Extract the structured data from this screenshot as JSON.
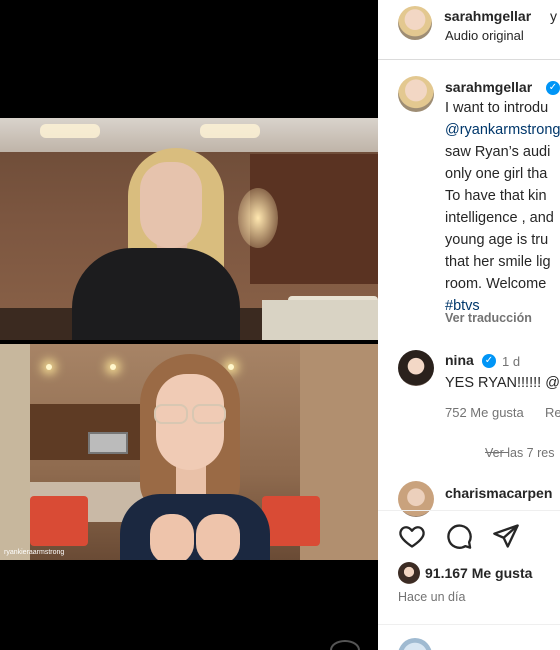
{
  "video": {
    "participant_label": "ryankieraarmstrong"
  },
  "header": {
    "username": "sarahmgellar",
    "suffix": "y",
    "audio": "Audio original"
  },
  "caption": {
    "username": "sarahmgellar",
    "lines": [
      "I want to introdu",
      "@ryankarmstrong",
      "saw Ryan’s audi",
      "only one girl tha",
      "To have that kin",
      "intelligence , and",
      "young age is tru",
      "that her smile lig",
      "room. Welcome",
      "#btvs"
    ],
    "translate": "Ver traducción"
  },
  "comment": {
    "username": "nina",
    "age": "1 d",
    "text": "YES RYAN!!!!!! @",
    "likes": "752 Me gusta",
    "reply": "Re",
    "view_replies": "Ver las 7 res"
  },
  "comment2": {
    "username": "charismacarpen"
  },
  "likes": {
    "count": "91.167 Me gusta"
  },
  "posted": "Hace un día",
  "icons": {
    "like": "heart-icon",
    "comment": "comment-icon",
    "share": "share-icon"
  },
  "colors": {
    "verified": "#0095f6",
    "link": "#00376b"
  }
}
